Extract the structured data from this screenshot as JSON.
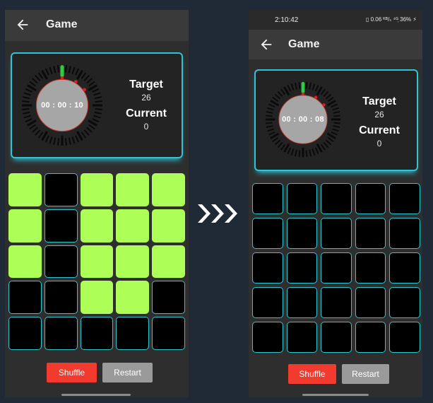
{
  "colors": {
    "background": "#1f2a36",
    "accent_cyan": "#2ec4d6",
    "tile_on": "#adff57",
    "tile_off": "#000000",
    "shuffle": "#f23a2e",
    "restart": "#9a9a9a"
  },
  "before": {
    "appbar": {
      "title": "Game",
      "back_icon": "arrow-left-icon"
    },
    "timer": {
      "time": "00 : 00 : 10"
    },
    "stats": {
      "target_label": "Target",
      "target_value": "26",
      "current_label": "Current",
      "current_value": "0"
    },
    "grid": {
      "rows": 5,
      "cols": 5,
      "tiles": [
        1,
        0,
        1,
        1,
        1,
        1,
        0,
        1,
        1,
        1,
        1,
        0,
        1,
        1,
        1,
        0,
        0,
        1,
        1,
        0,
        0,
        0,
        0,
        0,
        0
      ]
    },
    "buttons": {
      "shuffle": "Shuffle",
      "restart": "Restart"
    }
  },
  "transition_icon": "triple-chevron-right-icon",
  "after": {
    "status_bar": {
      "time": "2:10:42",
      "icons": "▯ 0.06 ᴷᴮ/ₛ ⁴ᴳ᷊ 36% ⚡",
      "battery": "36%"
    },
    "appbar": {
      "title": "Game",
      "back_icon": "arrow-left-icon"
    },
    "timer": {
      "time": "00 : 00 : 08"
    },
    "stats": {
      "target_label": "Target",
      "target_value": "26",
      "current_label": "Current",
      "current_value": "0"
    },
    "grid": {
      "rows": 5,
      "cols": 5,
      "tiles": [
        0,
        0,
        0,
        0,
        0,
        0,
        0,
        0,
        0,
        0,
        0,
        0,
        0,
        0,
        0,
        0,
        0,
        0,
        0,
        0,
        0,
        0,
        0,
        0,
        0
      ]
    },
    "buttons": {
      "shuffle": "Shuffle",
      "restart": "Restart"
    }
  }
}
